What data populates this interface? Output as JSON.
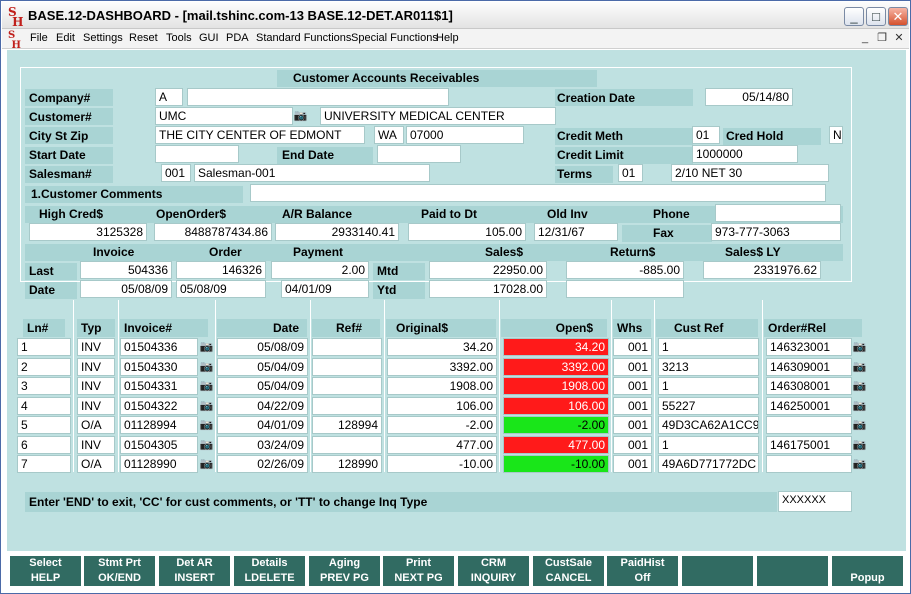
{
  "window": {
    "title": "BASE.12-DASHBOARD - [mail.tshinc.com-13 BASE.12-DET.AR011$1]",
    "logo_text": "SH"
  },
  "menu": [
    "File",
    "Edit",
    "Settings",
    "Reset",
    "Tools",
    "GUI",
    "PDA",
    "Standard Functions",
    "Special Functions",
    "Help"
  ],
  "header": {
    "title": "Customer Accounts Receivables",
    "company_label": "Company#",
    "company_value": "A",
    "company_extra": "",
    "creation_date_label": "Creation Date",
    "creation_date": "05/14/80",
    "customer_label": "Customer#",
    "customer_value": "UMC",
    "customer_name": "UNIVERSITY MEDICAL CENTER",
    "city_label": "City St Zip",
    "city": "THE CITY CENTER OF EDMONT",
    "state": "WA",
    "zip": "07000",
    "credit_meth_label": "Credit Meth",
    "credit_meth": "01",
    "cred_hold_label": "Cred Hold",
    "cred_hold": "N",
    "start_date_label": "Start Date",
    "start_date": "",
    "end_date_label": "End Date",
    "end_date": "",
    "credit_limit_label": "Credit Limit",
    "credit_limit": "1000000",
    "salesman_label": "Salesman#",
    "salesman_code": "001",
    "salesman_name": "Salesman-001",
    "terms_label": "Terms",
    "terms_code": "01",
    "terms_desc": "2/10 NET  30",
    "comments_label": "1.Customer Comments",
    "comments": "",
    "high_cred_label": "High Cred$",
    "high_cred": "3125328",
    "open_order_label": "OpenOrder$",
    "open_order": "8488787434.86",
    "ar_balance_label": "A/R Balance",
    "ar_balance": "2933140.41",
    "paid_to_dt_label": "Paid to Dt",
    "paid_to_dt": "105.00",
    "old_inv_label": "Old Inv",
    "old_inv": "12/31/67",
    "phone_label": "Phone",
    "phone": "",
    "fax_label": "Fax",
    "fax": "973-777-3063",
    "invoice_label": "Invoice",
    "order_label": "Order",
    "payment_label": "Payment",
    "sales_label": "Sales$",
    "return_label": "Return$",
    "sales_ly_label": "Sales$ LY",
    "last_label": "Last",
    "date_label": "Date",
    "mtd_label": "Mtd",
    "ytd_label": "Ytd",
    "last_invoice": "504336",
    "last_order": "146326",
    "last_payment": "2.00",
    "mtd_sales": "22950.00",
    "mtd_return": "-885.00",
    "sales_ly": "2331976.62",
    "date_invoice": "05/08/09",
    "date_order": "05/08/09",
    "date_payment": "04/01/09",
    "ytd_sales": "17028.00",
    "ytd_return": ""
  },
  "table": {
    "columns": [
      "Ln#",
      "Typ",
      "Invoice#",
      "Date",
      "Ref#",
      "Original$",
      "Open$",
      "Whs",
      "Cust Ref",
      "Order#Rel"
    ],
    "rows": [
      {
        "ln": "1",
        "typ": "INV",
        "invoice": "01504336",
        "date": "05/08/09",
        "ref": "",
        "original": "34.20",
        "open": "34.20",
        "open_color": "red",
        "whs": "001",
        "custref": "1",
        "order": "146323001"
      },
      {
        "ln": "2",
        "typ": "INV",
        "invoice": "01504330",
        "date": "05/04/09",
        "ref": "",
        "original": "3392.00",
        "open": "3392.00",
        "open_color": "red",
        "whs": "001",
        "custref": "3213",
        "order": "146309001"
      },
      {
        "ln": "3",
        "typ": "INV",
        "invoice": "01504331",
        "date": "05/04/09",
        "ref": "",
        "original": "1908.00",
        "open": "1908.00",
        "open_color": "red",
        "whs": "001",
        "custref": "1",
        "order": "146308001"
      },
      {
        "ln": "4",
        "typ": "INV",
        "invoice": "01504322",
        "date": "04/22/09",
        "ref": "",
        "original": "106.00",
        "open": "106.00",
        "open_color": "red",
        "whs": "001",
        "custref": "55227",
        "order": "146250001"
      },
      {
        "ln": "5",
        "typ": "O/A",
        "invoice": "01128994",
        "date": "04/01/09",
        "ref": "128994",
        "original": "-2.00",
        "open": "-2.00",
        "open_color": "green",
        "whs": "001",
        "custref": "49D3CA62A1CC9",
        "order": ""
      },
      {
        "ln": "6",
        "typ": "INV",
        "invoice": "01504305",
        "date": "03/24/09",
        "ref": "",
        "original": "477.00",
        "open": "477.00",
        "open_color": "red",
        "whs": "001",
        "custref": "1",
        "order": "146175001"
      },
      {
        "ln": "7",
        "typ": "O/A",
        "invoice": "01128990",
        "date": "02/26/09",
        "ref": "128990",
        "original": "-10.00",
        "open": "-10.00",
        "open_color": "green",
        "whs": "001",
        "custref": "49A6D771772DC",
        "order": ""
      }
    ]
  },
  "footer": {
    "prompt": "Enter 'END' to exit, 'CC' for cust comments, or 'TT' to change Inq Type",
    "input": "XXXXXX"
  },
  "fkeys_top": [
    "Select",
    "Stmt Prt",
    "Det AR",
    "Details",
    "Aging",
    "Print",
    "CRM",
    "CustSale",
    "PaidHist",
    "",
    "",
    ""
  ],
  "fkeys_bottom": [
    "HELP",
    "OK/END",
    "INSERT",
    "LDELETE",
    "PREV PG",
    "NEXT PG",
    "INQUIRY",
    "CANCEL",
    "Off",
    "",
    "",
    "Popup"
  ],
  "icons": {
    "lookup": "camera-icon",
    "minimize": "minimize-icon",
    "maximize": "maximize-icon",
    "close": "close-icon"
  },
  "colors": {
    "background": "#bfe1e1",
    "label_bar": "#a9d4d4",
    "fkey": "#316b62",
    "open_positive": "#ff1a1a",
    "open_negative": "#19e619"
  }
}
